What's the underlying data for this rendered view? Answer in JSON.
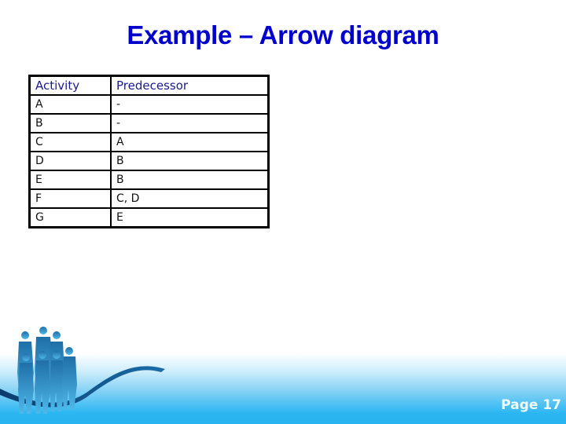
{
  "slide": {
    "title": "Example – Arrow diagram",
    "page_label": "Page 17"
  },
  "table": {
    "headers": [
      "Activity",
      "Predecessor"
    ],
    "rows": [
      {
        "activity": "A",
        "predecessor": "-"
      },
      {
        "activity": "B",
        "predecessor": "-"
      },
      {
        "activity": "C",
        "predecessor": "A"
      },
      {
        "activity": "D",
        "predecessor": "B"
      },
      {
        "activity": "E",
        "predecessor": "B"
      },
      {
        "activity": "F",
        "predecessor": "C, D"
      },
      {
        "activity": "G",
        "predecessor": "E"
      }
    ]
  },
  "decoration": {
    "graphic": "business-people-silhouettes-icon",
    "colors": {
      "title": "#0000cc",
      "header_text": "#1a1a8c",
      "band": "#27b3ef"
    }
  }
}
